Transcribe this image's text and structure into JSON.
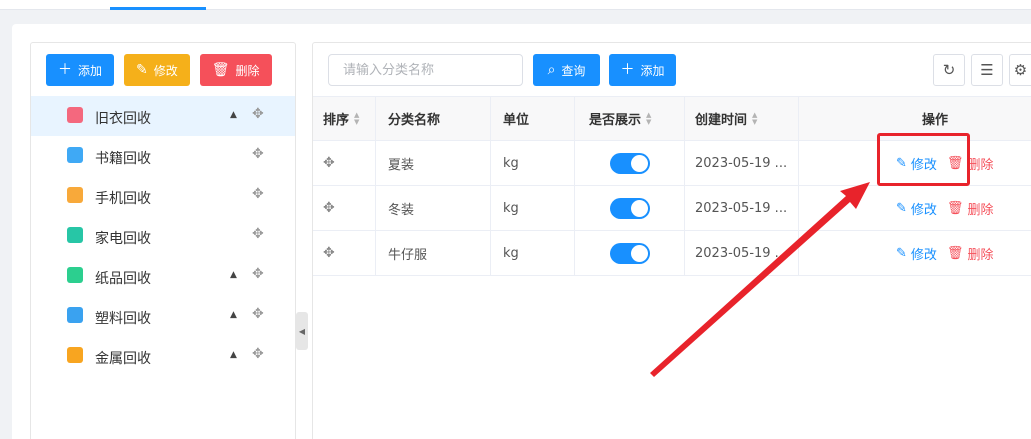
{
  "left_toolbar": {
    "add_label": "添加",
    "edit_label": "修改",
    "delete_label": "删除"
  },
  "tree": {
    "items": [
      {
        "label": "旧衣回收",
        "icon": "clothes-icon",
        "color": "#f4687e",
        "caret": "▲",
        "selected": true
      },
      {
        "label": "书籍回收",
        "icon": "book-icon",
        "color": "#3fa9f5",
        "caret": "",
        "selected": false
      },
      {
        "label": "手机回收",
        "icon": "phone-icon",
        "color": "#f8a93a",
        "caret": "",
        "selected": false
      },
      {
        "label": "家电回收",
        "icon": "appliance-icon",
        "color": "#27c6a6",
        "caret": "",
        "selected": false
      },
      {
        "label": "纸品回收",
        "icon": "paper-box-icon",
        "color": "#2ccf8f",
        "caret": "▲",
        "selected": false
      },
      {
        "label": "塑料回收",
        "icon": "plastic-bottle-icon",
        "color": "#3aa2f0",
        "caret": "▲",
        "selected": false
      },
      {
        "label": "金属回收",
        "icon": "metal-bars-icon",
        "color": "#f8a520",
        "caret": "▲",
        "selected": false
      }
    ]
  },
  "search": {
    "placeholder": "请输入分类名称",
    "query_label": "查询",
    "add_label": "添加"
  },
  "table": {
    "headers": {
      "sort": "排序",
      "name": "分类名称",
      "unit": "单位",
      "show": "是否展示",
      "created": "创建时间",
      "actions": "操作"
    },
    "edit_label": "修改",
    "delete_label": "删除",
    "rows": [
      {
        "name": "夏装",
        "unit": "kg",
        "created": "2023-05-19 ...",
        "shown": true
      },
      {
        "name": "冬装",
        "unit": "kg",
        "created": "2023-05-19 ...",
        "shown": true
      },
      {
        "name": "牛仔服",
        "unit": "kg",
        "created": "2023-05-19 ...",
        "shown": true
      }
    ]
  },
  "colors": {
    "primary": "#1890ff",
    "warning": "#f5b01a",
    "danger": "#f5505a",
    "annotation": "#e8232b"
  }
}
